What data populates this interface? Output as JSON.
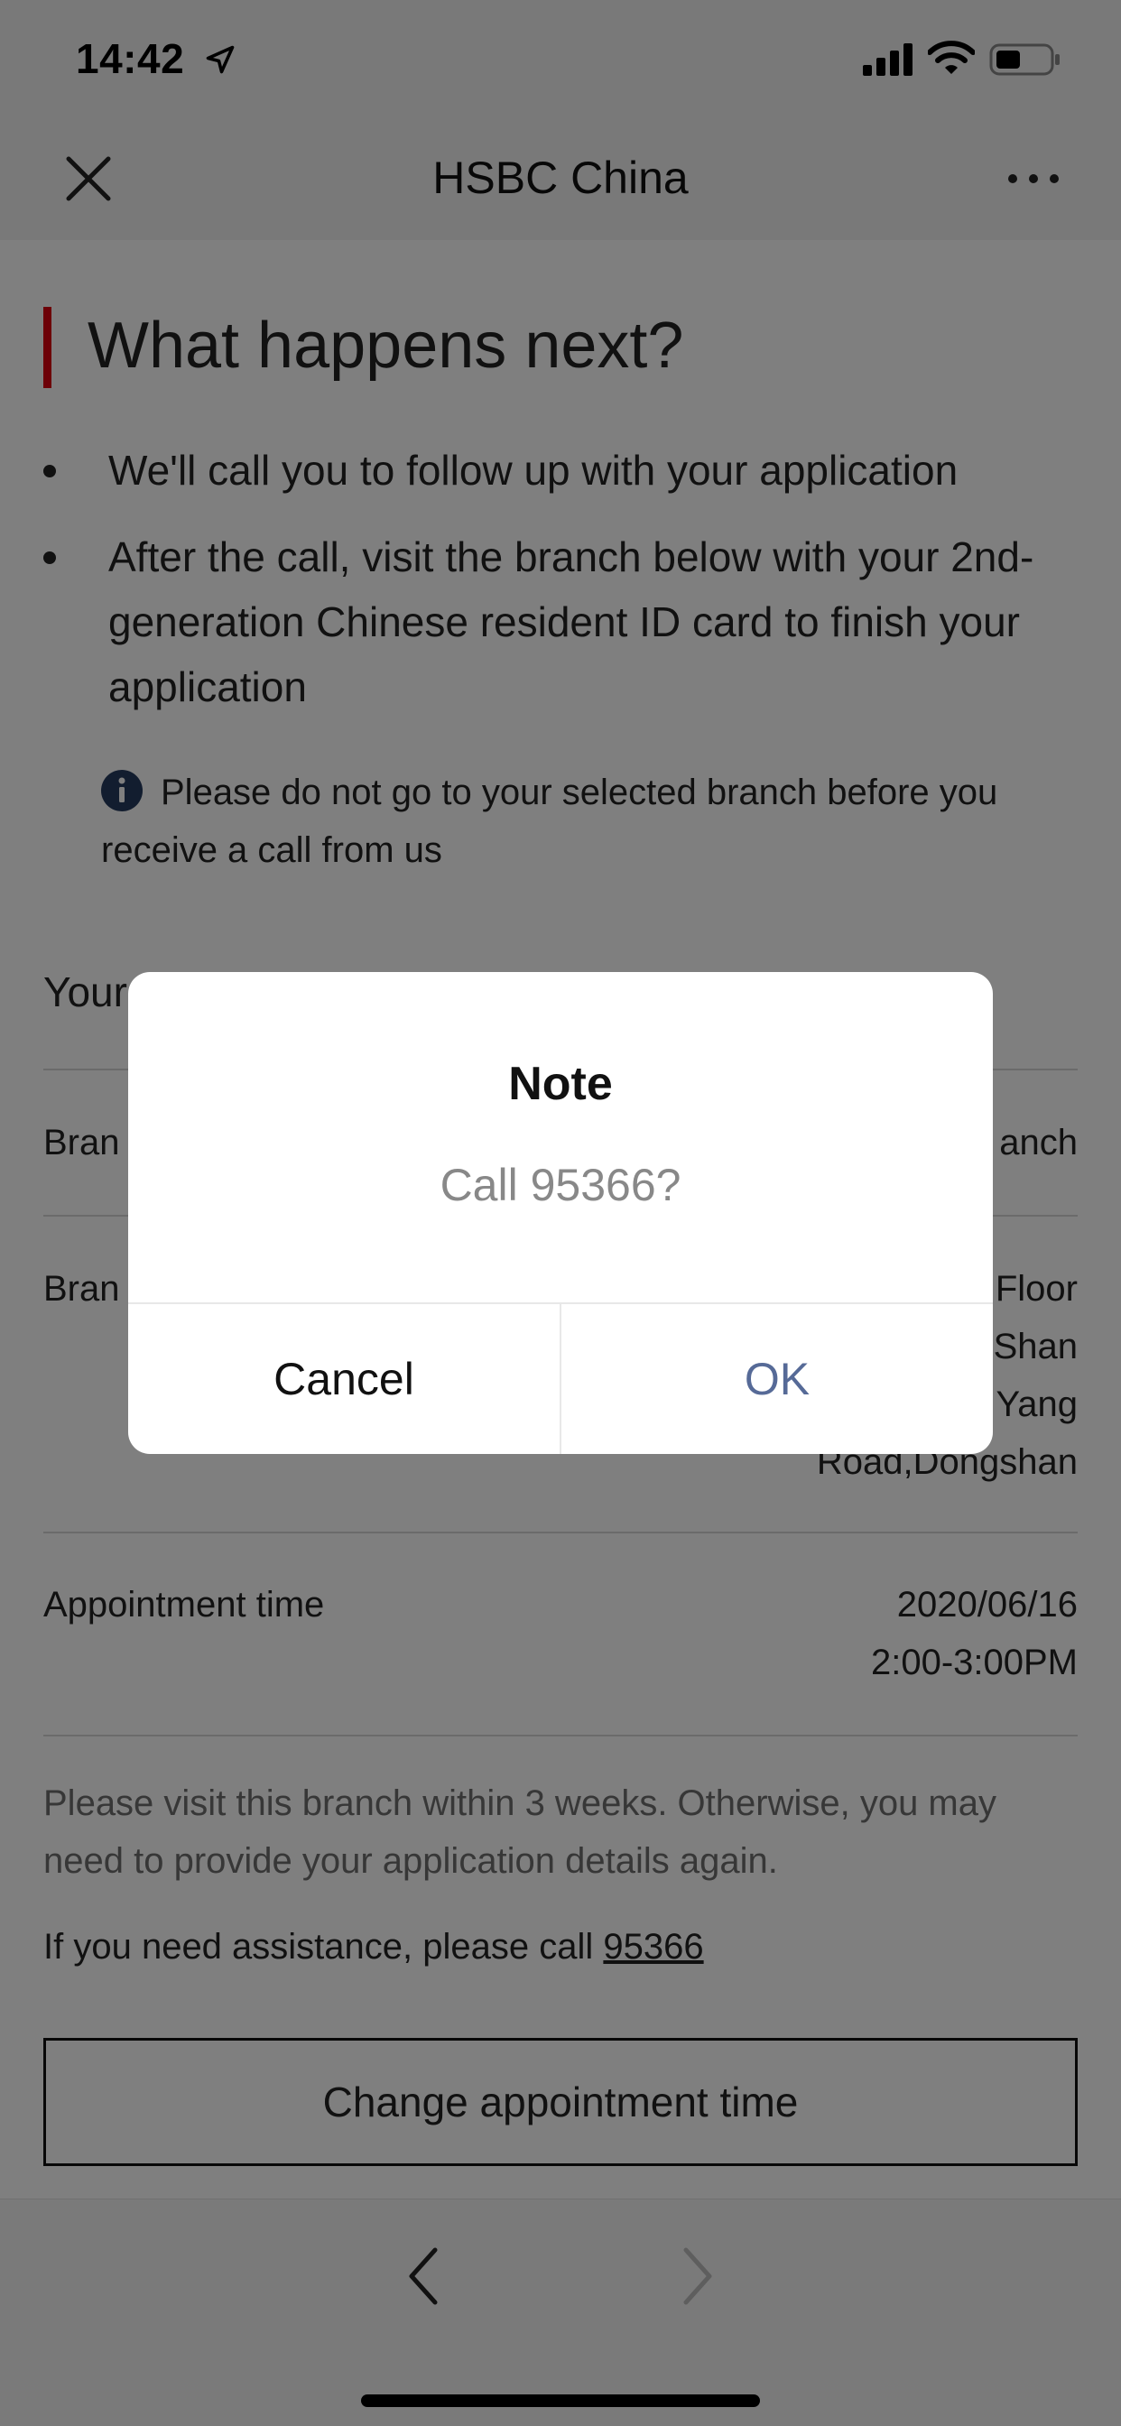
{
  "status_bar": {
    "time": "14:42"
  },
  "nav": {
    "title": "HSBC China"
  },
  "content": {
    "heading": "What happens next?",
    "bullets": [
      "We'll call you to follow up with your application",
      "After the call, visit the branch below with your 2nd-generation Chinese resident ID card to finish your application"
    ],
    "info_note": "Please do not go to your selected branch before you receive a call from us",
    "section_title": "Your",
    "rows": [
      {
        "label": "Bran",
        "value": "anch"
      },
      {
        "label": "Bran",
        "value_lines": [
          "Floor",
          "Shan",
          "Yang",
          "Road,Dongshan"
        ]
      },
      {
        "label": "Appointment time",
        "value_lines": [
          "2020/06/16",
          "2:00-3:00PM"
        ]
      }
    ],
    "visit_note": "Please visit this branch within 3 weeks. Otherwise, you may need to provide your application details again.",
    "assist_prefix": "If you need assistance, please call",
    "assist_phone": "95366",
    "change_button": "Change appointment time"
  },
  "dialog": {
    "title": "Note",
    "message": "Call 95366?",
    "cancel": "Cancel",
    "ok": "OK"
  },
  "colors": {
    "accent_red": "#db0011",
    "ok_blue": "#566a97",
    "info_navy": "#253a5e"
  }
}
